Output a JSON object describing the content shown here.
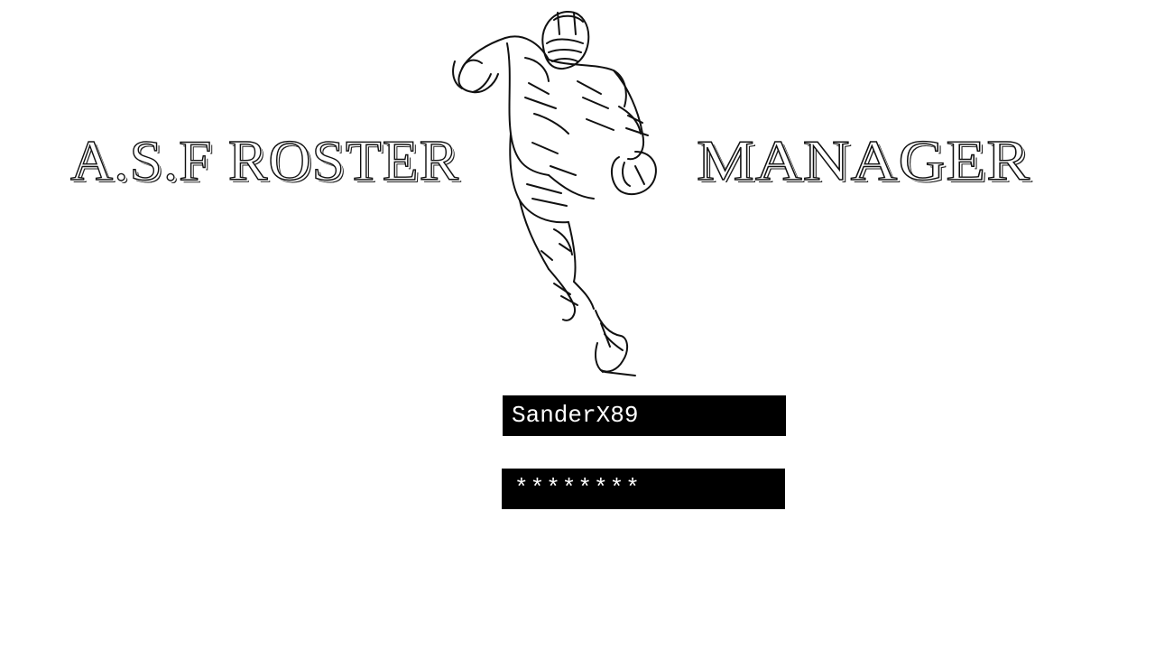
{
  "app": {
    "title_left": "A.S.F ROSTER",
    "title_right": "MANAGER",
    "logo_icon": "football-player-icon"
  },
  "login": {
    "username_value": "SanderX89",
    "password_value": "********"
  },
  "colors": {
    "background": "#ffffff",
    "field_background": "#000000",
    "field_text": "#ffffff",
    "outline": "#111111"
  }
}
